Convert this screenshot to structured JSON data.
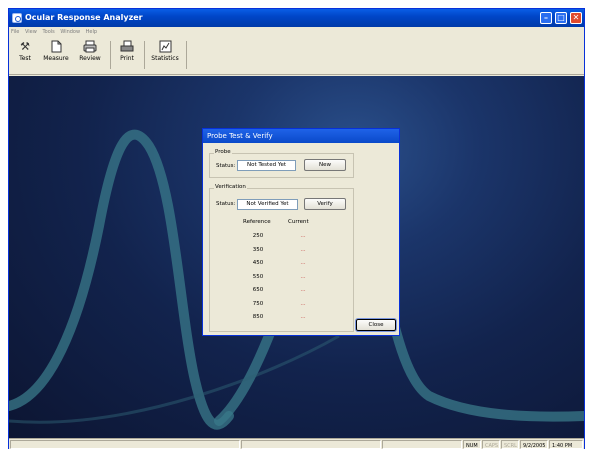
{
  "window": {
    "title": "Ocular Response Analyzer",
    "minimize": "–",
    "restore": "□",
    "close": "✕"
  },
  "menu": [
    "File",
    "View",
    "Tools",
    "Window",
    "Help"
  ],
  "toolbar": [
    {
      "label": "Test",
      "icon": "tools-icon"
    },
    {
      "label": "Measure",
      "icon": "page-icon"
    },
    {
      "label": "Review",
      "icon": "printer-review-icon"
    },
    {
      "label": "Print",
      "icon": "printer-icon"
    },
    {
      "label": "Statistics",
      "icon": "chart-icon"
    }
  ],
  "dialog": {
    "title": "Probe Test & Verify",
    "probe": {
      "group_label": "Probe",
      "status_label": "Status:",
      "status_value": "Not Tested Yet",
      "button": "New"
    },
    "verification": {
      "group_label": "Verification",
      "status_label": "Status:",
      "status_value": "Not Verified Yet",
      "button": "Verify",
      "col_reference": "Reference",
      "col_current": "Current",
      "rows": [
        {
          "reference": "250",
          "current": "..."
        },
        {
          "reference": "350",
          "current": "..."
        },
        {
          "reference": "450",
          "current": "..."
        },
        {
          "reference": "550",
          "current": "..."
        },
        {
          "reference": "650",
          "current": "..."
        },
        {
          "reference": "750",
          "current": "..."
        },
        {
          "reference": "850",
          "current": "..."
        }
      ]
    },
    "close_button": "Close"
  },
  "statusbar": {
    "num": "NUM",
    "caps": "CAPS",
    "scrl": "SCRL",
    "date": "9/2/2005",
    "time": "1:40 PM"
  },
  "colors": {
    "title_bar": "#0a5ee6",
    "desktop": "#12234d",
    "curve": "#3a7a8a"
  }
}
